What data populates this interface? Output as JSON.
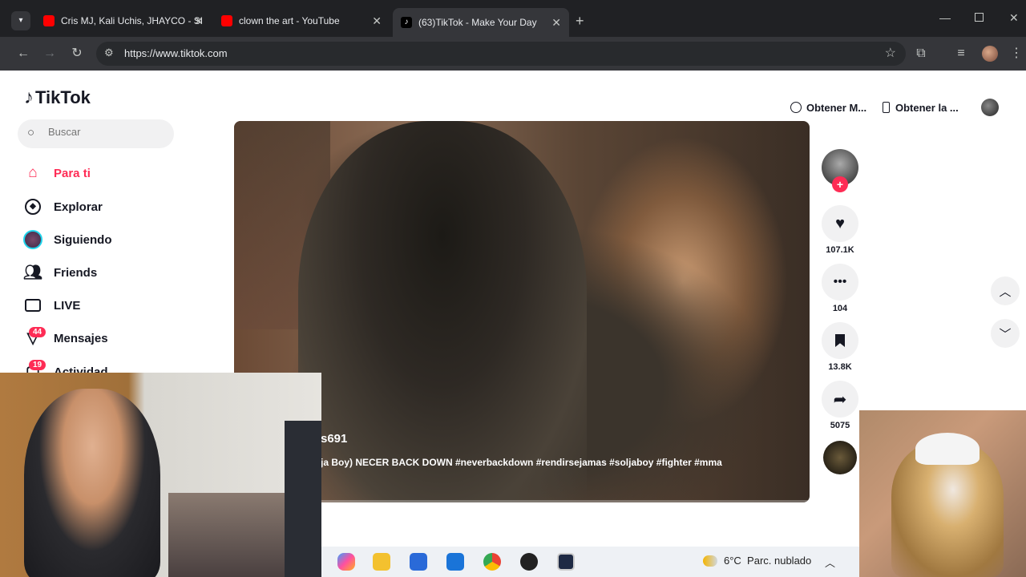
{
  "browser": {
    "tabs": [
      {
        "title": "Cris MJ, Kali Uchis, JHAYCO - SI",
        "favicon": "youtube-icon",
        "active": false
      },
      {
        "title": "clown the art - YouTube",
        "favicon": "youtube-icon",
        "active": false
      },
      {
        "title": "(63)TikTok - Make Your Day",
        "favicon": "tiktok-icon",
        "active": true
      }
    ],
    "url": "https://www.tiktok.com"
  },
  "tiktok": {
    "logo": "TikTok",
    "search_placeholder": "Buscar",
    "nav": [
      {
        "label": "Para ti",
        "icon": "home-icon",
        "active": true
      },
      {
        "label": "Explorar",
        "icon": "compass-icon"
      },
      {
        "label": "Siguiendo",
        "icon": "following-avatar-icon"
      },
      {
        "label": "Friends",
        "icon": "friends-icon"
      },
      {
        "label": "LIVE",
        "icon": "live-icon"
      },
      {
        "label": "Mensajes",
        "icon": "messages-icon",
        "badge": "44"
      },
      {
        "label": "Actividad",
        "icon": "activity-icon",
        "badge": "19"
      }
    ],
    "top_buttons": {
      "get_coins": "Obtener M...",
      "get_app": "Obtener la ..."
    },
    "video": {
      "username": "s691",
      "description": "ja Boy) NECER BACK DOWN #neverbackdown #rendirsejamas #soljaboy #fighter #mma"
    },
    "actions": {
      "likes": "107.1K",
      "comments": "104",
      "saves": "13.8K",
      "shares": "5075"
    }
  },
  "taskbar": {
    "weather": "6°C  Parc. nublado"
  },
  "colors": {
    "accent": "#fe2c55",
    "chrome_bg": "#202124",
    "toolbar_bg": "#35363a"
  }
}
